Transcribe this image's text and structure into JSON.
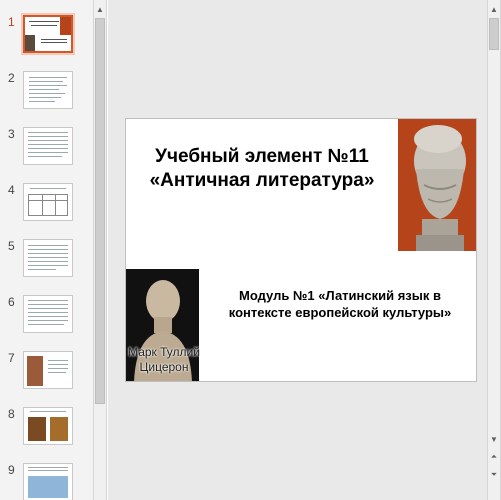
{
  "thumbnails": [
    {
      "number": "1",
      "active": true
    },
    {
      "number": "2",
      "active": false
    },
    {
      "number": "3",
      "active": false
    },
    {
      "number": "4",
      "active": false
    },
    {
      "number": "5",
      "active": false
    },
    {
      "number": "6",
      "active": false
    },
    {
      "number": "7",
      "active": false
    },
    {
      "number": "8",
      "active": false
    },
    {
      "number": "9",
      "active": false
    }
  ],
  "slide": {
    "title_line1": "Учебный элемент №11",
    "title_line2": "«Античная литература»",
    "subtitle_line1": "Модуль №1 «Латинский язык в",
    "subtitle_line2": "контексте европейской культуры»",
    "caption_line1": "Марк Туллий",
    "caption_line2": "Цицерон"
  },
  "colors": {
    "accent": "#d2572c",
    "bust_background": "#b5441a"
  },
  "icons": {
    "scroll_up": "triangle-up-icon",
    "scroll_down": "triangle-down-icon",
    "prev_slide": "double-up-arrow-icon",
    "next_slide": "double-down-arrow-icon"
  }
}
